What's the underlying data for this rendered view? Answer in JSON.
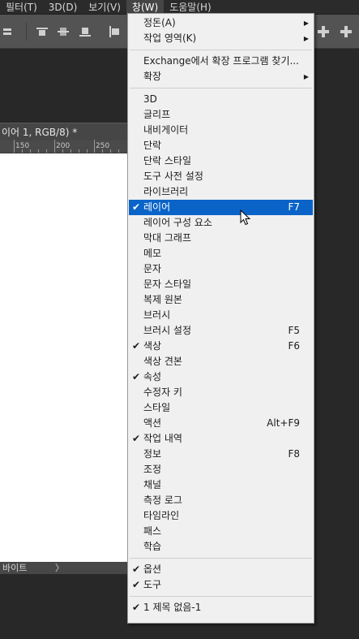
{
  "menubar": {
    "items": [
      {
        "label": "필터(T)",
        "active": false
      },
      {
        "label": "3D(D)",
        "active": false
      },
      {
        "label": "보기(V)",
        "active": false
      },
      {
        "label": "창(W)",
        "active": true
      },
      {
        "label": "도움말(H)",
        "active": false
      }
    ]
  },
  "document": {
    "tab_title": "이어 1, RGB/8) *",
    "ruler_numbers": [
      "150",
      "200",
      "250"
    ],
    "status_text": "바이트",
    "status_arrow": "〉"
  },
  "window_menu": {
    "items": [
      {
        "type": "item",
        "label": "정돈(A)",
        "submenu": true
      },
      {
        "type": "item",
        "label": "작업 영역(K)",
        "submenu": true
      },
      {
        "type": "separator"
      },
      {
        "type": "item",
        "label": "Exchange에서 확장 프로그램 찾기..."
      },
      {
        "type": "item",
        "label": "확장",
        "submenu": true
      },
      {
        "type": "separator"
      },
      {
        "type": "item",
        "label": "3D"
      },
      {
        "type": "item",
        "label": "글리프"
      },
      {
        "type": "item",
        "label": "내비게이터"
      },
      {
        "type": "item",
        "label": "단락"
      },
      {
        "type": "item",
        "label": "단락 스타일"
      },
      {
        "type": "item",
        "label": "도구 사전 설정"
      },
      {
        "type": "item",
        "label": "라이브러리"
      },
      {
        "type": "item",
        "label": "레이어",
        "checked": true,
        "shortcut": "F7",
        "highlighted": true
      },
      {
        "type": "item",
        "label": "레이어 구성 요소"
      },
      {
        "type": "item",
        "label": "막대 그래프"
      },
      {
        "type": "item",
        "label": "메모"
      },
      {
        "type": "item",
        "label": "문자"
      },
      {
        "type": "item",
        "label": "문자 스타일"
      },
      {
        "type": "item",
        "label": "복제 원본"
      },
      {
        "type": "item",
        "label": "브러시"
      },
      {
        "type": "item",
        "label": "브러시 설정",
        "shortcut": "F5"
      },
      {
        "type": "item",
        "label": "색상",
        "checked": true,
        "shortcut": "F6"
      },
      {
        "type": "item",
        "label": "색상 견본"
      },
      {
        "type": "item",
        "label": "속성",
        "checked": true
      },
      {
        "type": "item",
        "label": "수정자 키"
      },
      {
        "type": "item",
        "label": "스타일"
      },
      {
        "type": "item",
        "label": "액션",
        "shortcut": "Alt+F9"
      },
      {
        "type": "item",
        "label": "작업 내역",
        "checked": true
      },
      {
        "type": "item",
        "label": "정보",
        "shortcut": "F8"
      },
      {
        "type": "item",
        "label": "조정"
      },
      {
        "type": "item",
        "label": "채널"
      },
      {
        "type": "item",
        "label": "측정 로그"
      },
      {
        "type": "item",
        "label": "타임라인"
      },
      {
        "type": "item",
        "label": "패스"
      },
      {
        "type": "item",
        "label": "학습"
      },
      {
        "type": "separator"
      },
      {
        "type": "item",
        "label": "옵션",
        "checked": true
      },
      {
        "type": "item",
        "label": "도구",
        "checked": true
      },
      {
        "type": "separator"
      },
      {
        "type": "item",
        "label": "1 제목 없음-1",
        "checked": true
      }
    ]
  },
  "colors": {
    "highlight": "#0a64c8",
    "menu_bg": "#f0f0f0",
    "app_bg": "#282828"
  }
}
